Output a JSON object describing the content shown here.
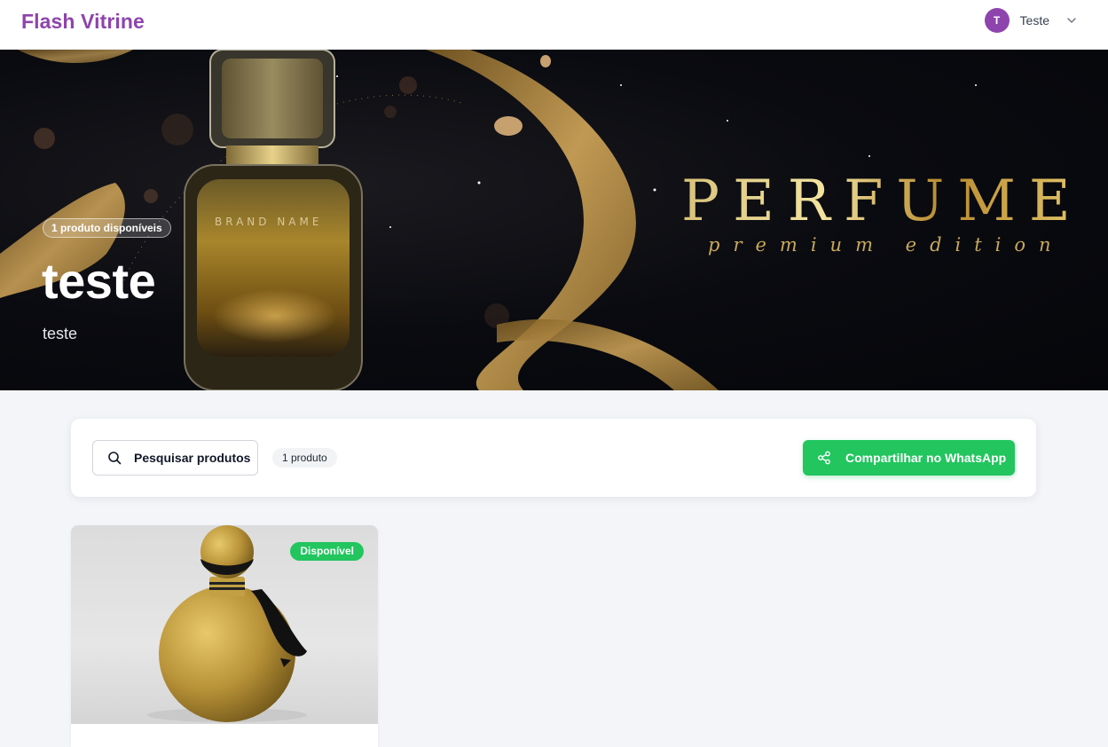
{
  "app": {
    "brand": "Flash Vitrine"
  },
  "user": {
    "initial": "T",
    "name": "Teste"
  },
  "hero": {
    "available_badge": "1 produto disponíveis",
    "title": "teste",
    "subtitle": "teste",
    "banner": {
      "word": "PERFUME",
      "tagline": "premium edition",
      "bottle_label": "BRAND NAME"
    }
  },
  "toolbar": {
    "search_label": "Pesquisar produtos",
    "count_label": "1 produto",
    "share_label": "Compartilhar no WhatsApp"
  },
  "products": [
    {
      "status": "Disponível"
    }
  ],
  "colors": {
    "brand": "#8e44ad",
    "whatsapp": "#22c55e",
    "gold": "#c9a95a"
  }
}
